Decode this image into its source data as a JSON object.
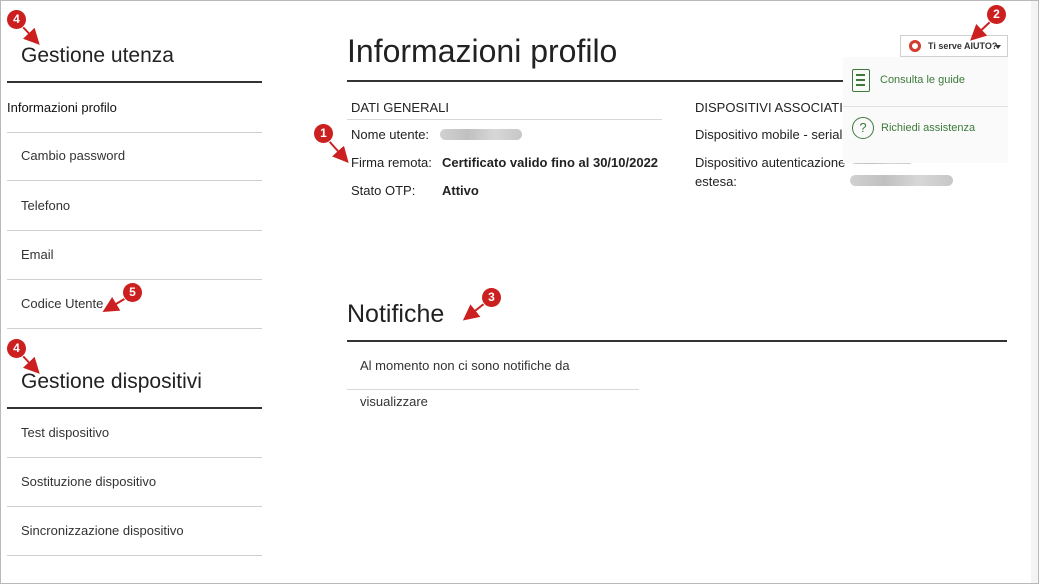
{
  "sidebar": {
    "heading_user": "Gestione utenza",
    "user_items": [
      {
        "label": "Informazioni profilo",
        "active": true
      },
      {
        "label": "Cambio password"
      },
      {
        "label": "Telefono"
      },
      {
        "label": "Email"
      },
      {
        "label": "Codice Utente"
      }
    ],
    "heading_devices": "Gestione dispositivi",
    "device_items": [
      {
        "label": "Test dispositivo"
      },
      {
        "label": "Sostituzione dispositivo"
      },
      {
        "label": "Sincronizzazione dispositivo"
      }
    ]
  },
  "main": {
    "title": "Informazioni profilo",
    "general": {
      "heading": "DATI GENERALI",
      "username_label": "Nome utente:",
      "remote_sign_label": "Firma remota:",
      "remote_sign_value": "Certificato valido fino al 30/10/2022",
      "otp_label": "Stato OTP:",
      "otp_value": "Attivo"
    },
    "devices": {
      "heading": "DISPOSITIVI ASSOCIATI",
      "mobile_label": "Dispositivo mobile - seriale",
      "extended_label_1": "Dispositivo autenticazione",
      "extended_label_2": "estesa:"
    },
    "notifications": {
      "title": "Notifiche",
      "empty_message": "Al momento non ci sono notifiche da visualizzare"
    }
  },
  "help": {
    "button_label": "Ti serve AIUTO?",
    "guides_label": "Consulta le guide",
    "assist_label": "Richiedi assistenza",
    "question_mark": "?"
  },
  "callouts": [
    "1",
    "2",
    "3",
    "4",
    "4",
    "5"
  ],
  "colors": {
    "callout": "#cc1f1f",
    "help_link": "#3d7a3a",
    "rule": "#333333"
  }
}
